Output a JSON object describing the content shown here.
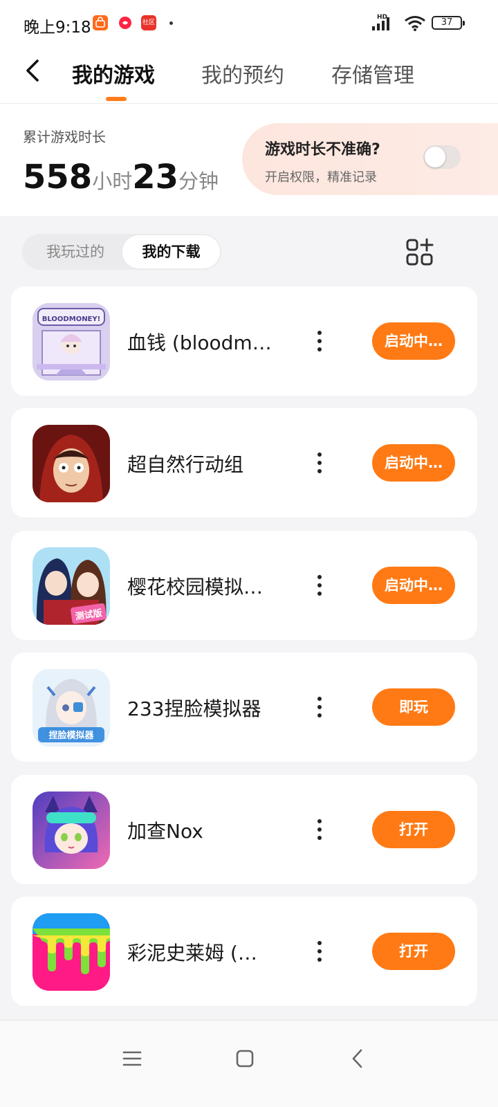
{
  "status_bar": {
    "time": "晚上9:18",
    "network_label": "HD",
    "battery": "37",
    "icons": [
      "taobao-app-icon",
      "xiaohongshu-app-icon",
      "community-app-icon",
      "signal-icon",
      "wifi-icon",
      "battery-icon"
    ],
    "community_badge": "社区"
  },
  "header": {
    "back_icon": "chevron-left-icon",
    "tabs": [
      {
        "label": "我的游戏",
        "active": true
      },
      {
        "label": "我的预约",
        "active": false
      },
      {
        "label": "存储管理",
        "active": false
      }
    ]
  },
  "playtime": {
    "label": "累计游戏时长",
    "hours": "558",
    "hours_unit": "小时",
    "minutes": "23",
    "minutes_unit": "分钟",
    "prompt_title": "游戏时长不准确?",
    "prompt_subtitle": "开启权限，精准记录",
    "toggle_on": false
  },
  "filter": {
    "segments": [
      {
        "label": "我玩过的",
        "active": false
      },
      {
        "label": "我的下载",
        "active": true
      }
    ],
    "manage_icon": "grid-add-icon"
  },
  "games": [
    {
      "name": "血钱 (bloodm…",
      "action": "启动中…",
      "icon_text": "BLOODMONEY!"
    },
    {
      "name": "超自然行动组",
      "action": "启动中…"
    },
    {
      "name": "樱花校园模拟…",
      "action": "启动中…",
      "icon_text": "测试版"
    },
    {
      "name": "233捏脸模拟器",
      "action": "即玩",
      "icon_text": "捏脸模拟器"
    },
    {
      "name": "加查Nox",
      "action": "打开"
    },
    {
      "name": "彩泥史莱姆 (…",
      "action": "打开"
    }
  ],
  "nav_bar": {
    "icons": [
      "menu-icon",
      "home-square-icon",
      "back-triangle-icon"
    ]
  },
  "colors": {
    "accent": "#ff7a14",
    "prompt_bg": "#fde6de",
    "page_bg": "#f4f4f6"
  }
}
